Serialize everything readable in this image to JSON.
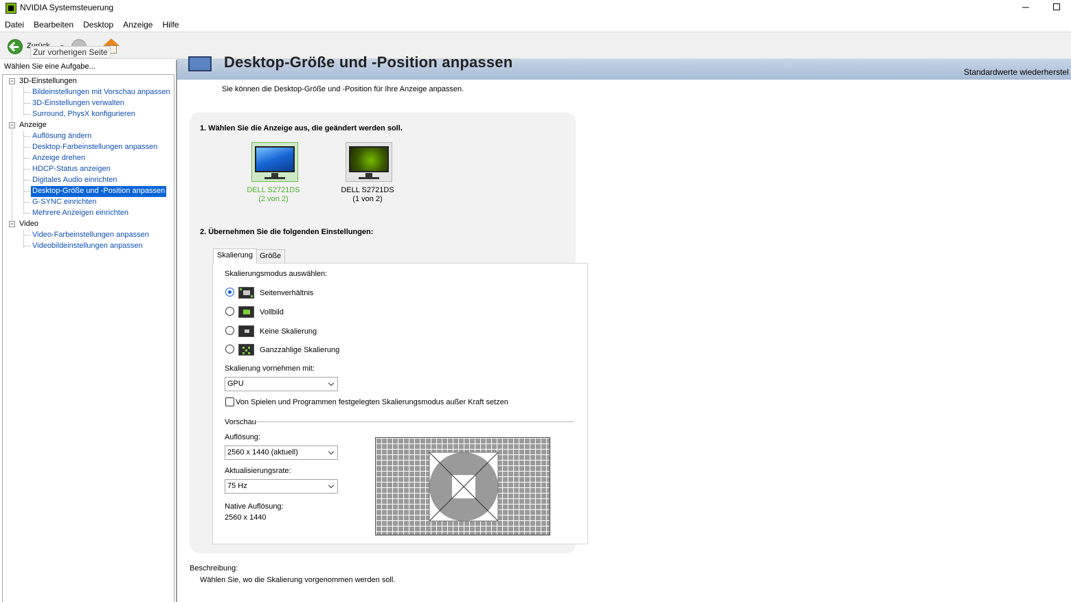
{
  "window": {
    "title": "NVIDIA Systemsteuerung",
    "minimize": "─"
  },
  "menu": [
    "Datei",
    "Bearbeiten",
    "Desktop",
    "Anzeige",
    "Hilfe"
  ],
  "toolbar": {
    "back_label": "Zurück",
    "back_tooltip": "Zur vorherigen Seite",
    "dropdown_arrow": "▾"
  },
  "sidebar": {
    "header": "Wählen Sie eine Aufgabe...",
    "categories": [
      {
        "label": "3D-Einstellungen",
        "toggle": "−",
        "items": [
          "Bildeinstellungen mit Vorschau anpassen",
          "3D-Einstellungen verwalten",
          "Surround, PhysX konfigurieren"
        ]
      },
      {
        "label": "Anzeige",
        "toggle": "−",
        "items": [
          "Auflösung ändern",
          "Desktop-Farbeinstellungen anpassen",
          "Anzeige drehen",
          "HDCP-Status anzeigen",
          "Digitales Audio einrichten",
          "Desktop-Größe und -Position anpassen",
          "G-SYNC einrichten",
          "Mehrere Anzeigen einrichten"
        ]
      },
      {
        "label": "Video",
        "toggle": "−",
        "items": [
          "Video-Farbeinstellungen anpassen",
          "Videobildeinstellungen anpassen"
        ]
      }
    ],
    "selected": "Desktop-Größe und -Position anpassen"
  },
  "page": {
    "title": "Desktop-Größe und -Position anpassen",
    "restore": "Standardwerte wiederherstel",
    "intro": "Sie können die Desktop-Größe und -Position für Ihre Anzeige anpassen.",
    "section1": "1. Wählen Sie die Anzeige aus, die geändert werden soll.",
    "displays": [
      {
        "name": "DELL S2721DS",
        "index": "(2 von 2)",
        "selected": true,
        "icon": "monitor-windows-icon"
      },
      {
        "name": "DELL S2721DS",
        "index": "(1 von 2)",
        "selected": false,
        "icon": "monitor-nvidia-icon"
      }
    ],
    "section2": "2. Übernehmen Sie die folgenden Einstellungen:",
    "tabs": [
      "Skalierung",
      "Größe"
    ],
    "active_tab": "Skalierung",
    "scaling": {
      "mode_label": "Skalierungsmodus auswählen:",
      "modes": [
        {
          "label": "Seitenverhältnis",
          "checked": true
        },
        {
          "label": "Vollbild",
          "checked": false
        },
        {
          "label": "Keine Skalierung",
          "checked": false
        },
        {
          "label": "Ganzzahlige Skalierung",
          "checked": false
        }
      ],
      "perform_label": "Skalierung vornehmen mit:",
      "perform_value": "GPU",
      "override_label": "Von Spielen und Programmen festgelegten Skalierungsmodus außer Kraft setzen",
      "override_checked": false
    },
    "preview": {
      "group_label": "Vorschau",
      "resolution_label": "Auflösung:",
      "resolution_value": "2560 x 1440 (aktuell)",
      "refresh_label": "Aktualisierungsrate:",
      "refresh_value": "75 Hz",
      "native_label": "Native Auflösung:",
      "native_value": "2560 x 1440"
    },
    "description": {
      "label": "Beschreibung:",
      "text": "Wählen Sie, wo die Skalierung vorgenommen werden soll."
    }
  },
  "colors": {
    "accent_green": "#76b900",
    "selection_blue": "#0a64d8",
    "link_blue": "#0d4fb5"
  }
}
